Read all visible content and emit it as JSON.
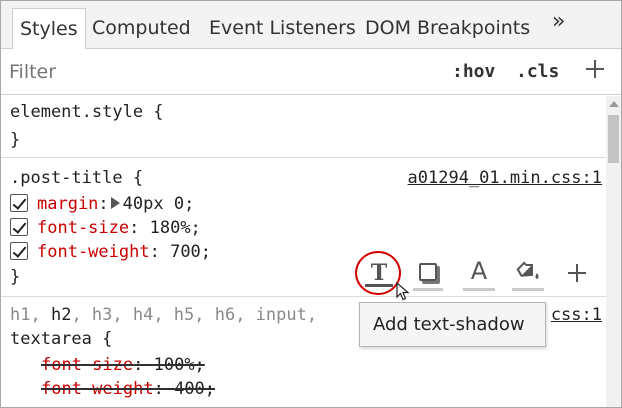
{
  "tabs": [
    {
      "label": "Styles",
      "active": true
    },
    {
      "label": "Computed",
      "active": false
    },
    {
      "label": "Event Listeners",
      "active": false
    },
    {
      "label": "DOM Breakpoints",
      "active": false
    }
  ],
  "tabs_more": "»",
  "filter": {
    "placeholder": "Filter",
    "value": "",
    "hov_label": ":hov",
    "cls_label": ".cls"
  },
  "rules": [
    {
      "selector": "element.style {",
      "close": "}"
    },
    {
      "selector": ".post-title {",
      "source": "a01294_01.min.css:1",
      "declarations": [
        {
          "prop": "margin",
          "value": "40px 0;",
          "checked": true,
          "expandable": true
        },
        {
          "prop": "font-size",
          "value": "180%;",
          "checked": true
        },
        {
          "prop": "font-weight",
          "value": "700;",
          "checked": true
        }
      ],
      "close": "}"
    },
    {
      "selector_grey_1": "h1, ",
      "selector_dark": "h2",
      "selector_grey_2": ", h3, h4, h5, h6, input,",
      "selector_line2": "textarea {",
      "source": "css:1",
      "declarations": [
        {
          "prop": "font-size",
          "value": "100%;",
          "overridden": true
        },
        {
          "prop": "font-weight",
          "value": "400;",
          "overridden": true
        }
      ]
    }
  ],
  "toolbar": {
    "text_shadow_icon": "text-shadow-icon",
    "box_shadow_icon": "box-shadow-icon",
    "color_icon": "text-color-icon",
    "background_icon": "background-color-icon",
    "add_icon": "plus-icon",
    "a_glyph": "A",
    "t_glyph": "T"
  },
  "tooltip": {
    "text": "Add text-shadow"
  },
  "colors": {
    "property": "#c80000",
    "highlight_circle": "#d40000"
  }
}
